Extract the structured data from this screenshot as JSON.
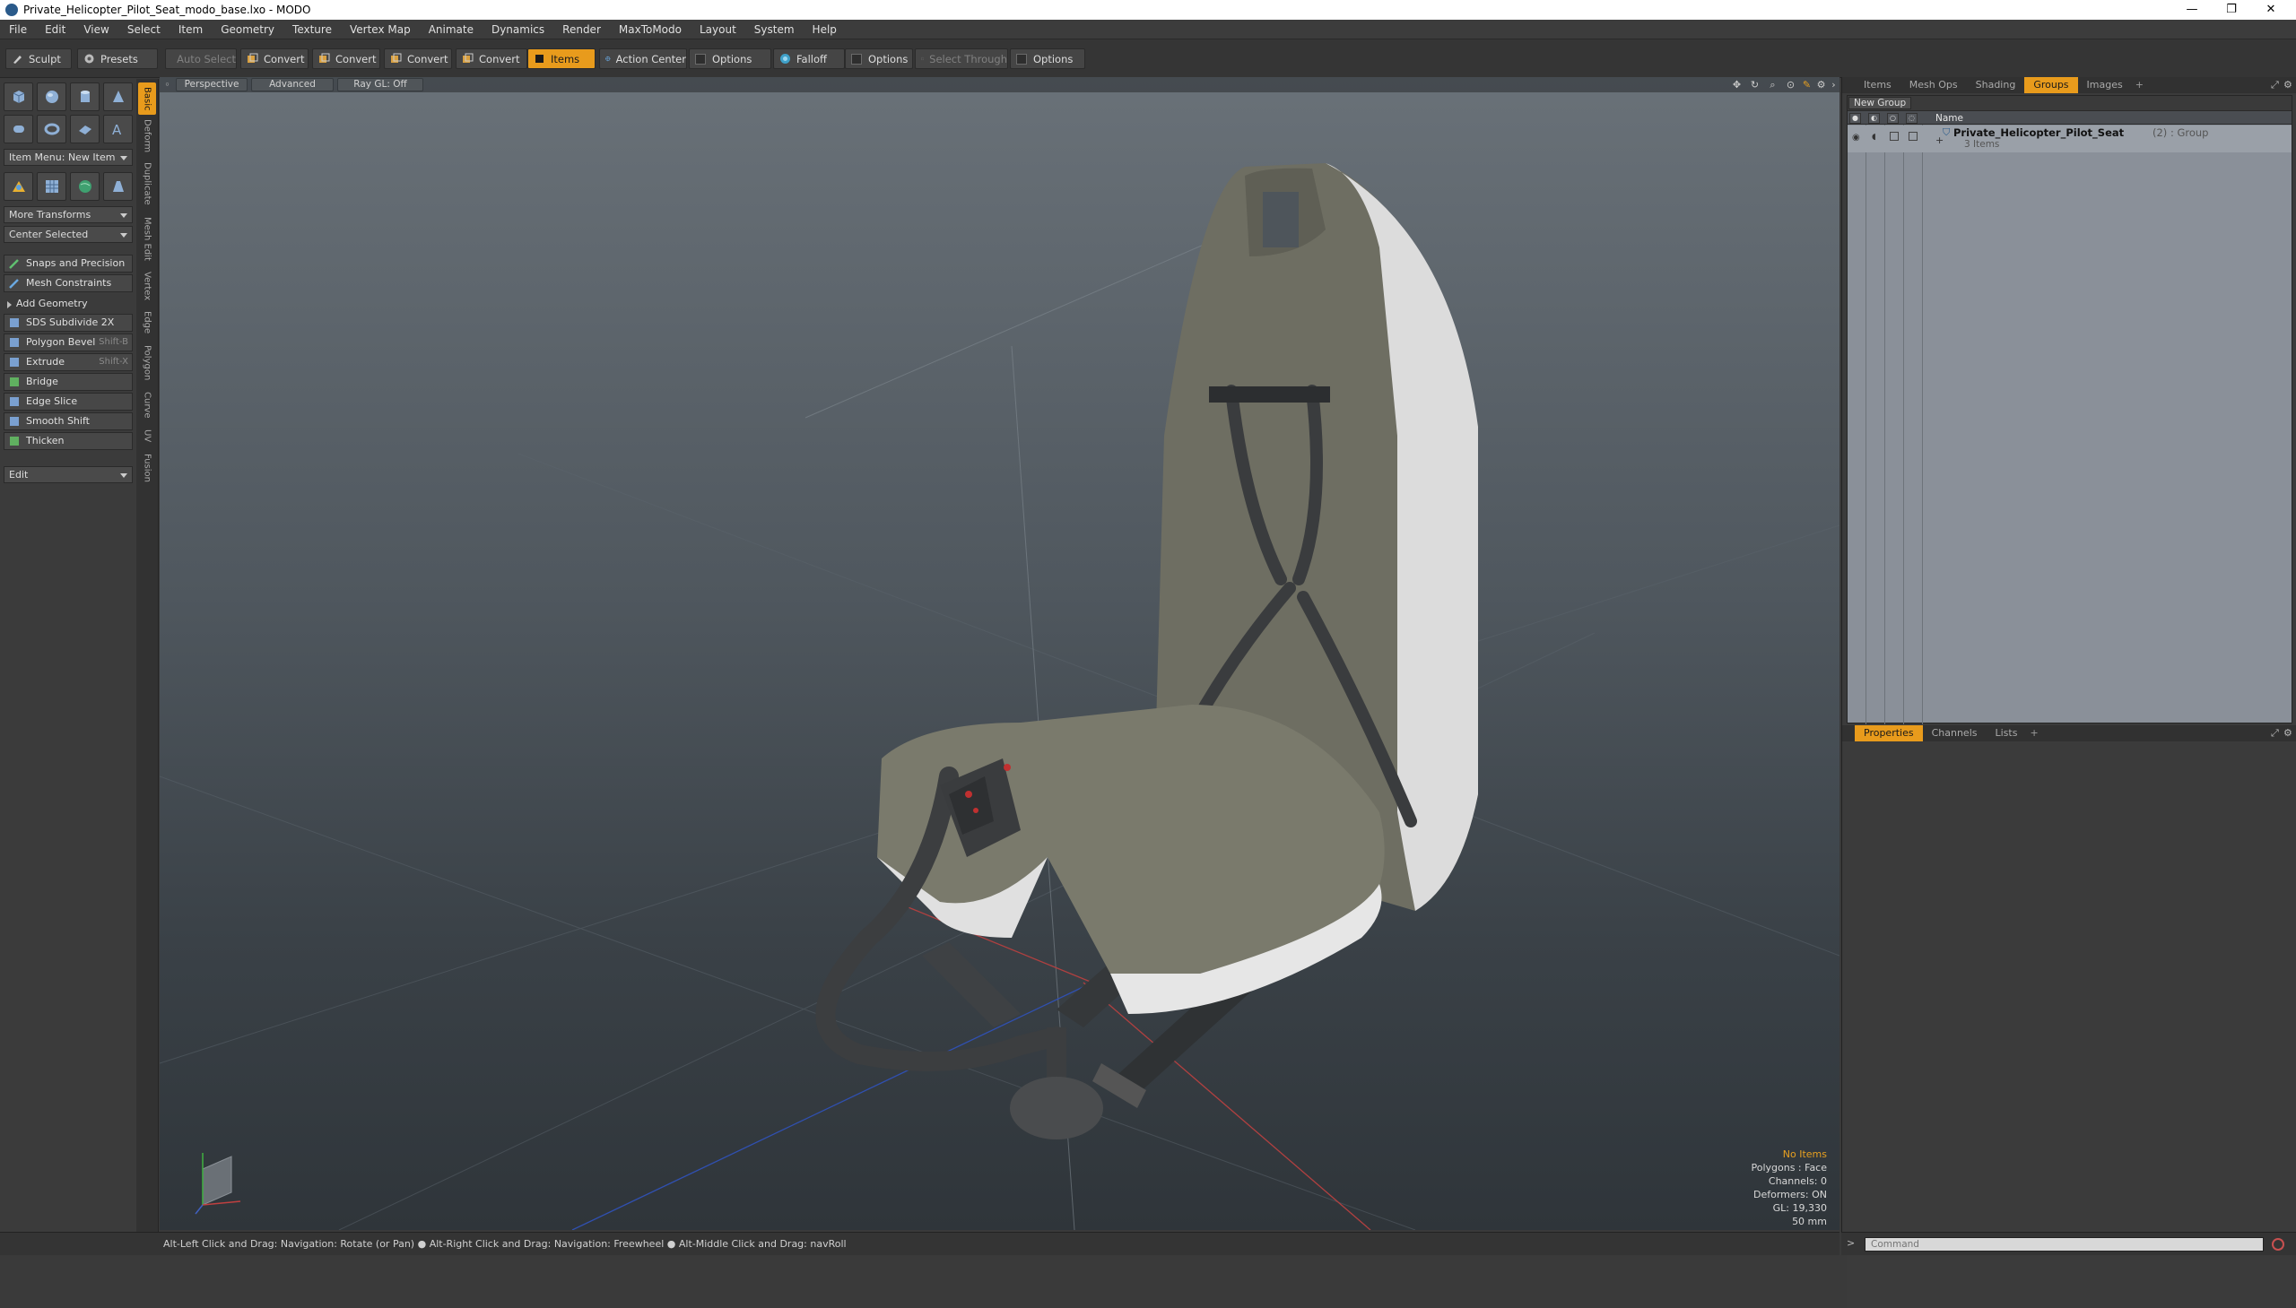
{
  "window": {
    "title": "Private_Helicopter_Pilot_Seat_modo_base.lxo - MODO",
    "minimize": "—",
    "restore": "❐",
    "close": "✕"
  },
  "menu": [
    "File",
    "Edit",
    "View",
    "Select",
    "Item",
    "Geometry",
    "Texture",
    "Vertex Map",
    "Animate",
    "Dynamics",
    "Render",
    "MaxToModo",
    "Layout",
    "System",
    "Help"
  ],
  "toolbar": {
    "sculpt": "Sculpt",
    "presets": "Presets",
    "auto_select": "Auto Select",
    "convert1": "Convert",
    "convert2": "Convert",
    "convert3": "Convert",
    "convert4": "Convert",
    "items": "Items",
    "action_center": "Action Center",
    "options1": "Options",
    "falloff": "Falloff",
    "options2": "Options",
    "select_through": "Select Through",
    "options3": "Options"
  },
  "left": {
    "item_menu": "Item Menu: New Item",
    "more_transforms": "More Transforms",
    "center_selected": "Center Selected",
    "snaps": "Snaps and Precision",
    "mesh_constraints": "Mesh Constraints",
    "add_geometry": "Add Geometry",
    "sds": "SDS Subdivide 2X",
    "polygon_bevel": "Polygon Bevel",
    "polygon_bevel_sc": "Shift-B",
    "extrude": "Extrude",
    "extrude_sc": "Shift-X",
    "bridge": "Bridge",
    "edge_slice": "Edge Slice",
    "smooth_shift": "Smooth Shift",
    "thicken": "Thicken",
    "edit": "Edit"
  },
  "side_tabs": [
    "Basic",
    "Deform",
    "Duplicate",
    "Mesh Edit",
    "Vertex",
    "Edge",
    "Polygon",
    "Curve",
    "UV",
    "Fusion"
  ],
  "viewport": {
    "perspective": "Perspective",
    "advanced": "Advanced",
    "raygl": "Ray GL: Off",
    "info": {
      "no_items": "No Items",
      "polygons": "Polygons : Face",
      "channels": "Channels: 0",
      "deformers": "Deformers: ON",
      "gl": "GL: 19,330",
      "focal": "50 mm"
    }
  },
  "status": "Alt-Left Click and Drag: Navigation: Rotate (or Pan) ● Alt-Right Click and Drag: Navigation: Freewheel ● Alt-Middle Click and Drag: navRoll",
  "right": {
    "tabs": [
      "Items",
      "Mesh Ops",
      "Shading",
      "Groups",
      "Images",
      "+"
    ],
    "new_group": "New Group",
    "col_name": "Name",
    "group_name": "Private_Helicopter_Pilot_Seat",
    "group_suffix": "(2) : Group",
    "group_items": "3 Items",
    "bottom_tabs": [
      "Properties",
      "Channels",
      "Lists",
      "+"
    ]
  },
  "command": {
    "placeholder": "Command"
  }
}
